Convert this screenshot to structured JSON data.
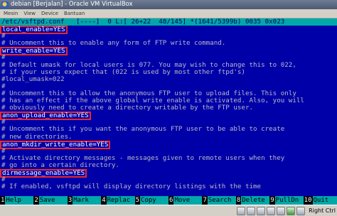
{
  "window": {
    "title": "debian [Berjalan] - Oracle VM VirtualBox"
  },
  "menu": [
    "Mesin",
    "View",
    "Device",
    "Bantuan"
  ],
  "status_line": "/etc/vsftpd.conf   [----]  0 L:[ 26+22  48/145] *(1641/5399b) 0035 0x023",
  "lines": [
    {
      "text": "local_enable=YES",
      "type": "config",
      "highlight": true
    },
    {
      "text": "#",
      "type": "comment"
    },
    {
      "text": "# Uncomment this to enable any form of FTP write command.",
      "type": "comment"
    },
    {
      "text": "write_enable=YES",
      "type": "config",
      "highlight": true
    },
    {
      "text": "#",
      "type": "comment"
    },
    {
      "text": "# Default umask for local users is 077. You may wish to change this to 022,",
      "type": "comment"
    },
    {
      "text": "# if your users expect that (022 is used by most other ftpd's)",
      "type": "comment"
    },
    {
      "text": "#local_umask=022",
      "type": "comment"
    },
    {
      "text": "#",
      "type": "comment"
    },
    {
      "text": "# Uncomment this to allow the anonymous FTP user to upload files. This only",
      "type": "comment"
    },
    {
      "text": "# has an effect if the above global write enable is activated. Also, you will",
      "type": "comment"
    },
    {
      "text": "# obviously need to create a directory writable by the FTP user.",
      "type": "comment"
    },
    {
      "text": "anon_upload_enable=YES",
      "type": "config",
      "highlight": true
    },
    {
      "text": "#",
      "type": "comment"
    },
    {
      "text": "# Uncomment this if you want the anonymous FTP user to be able to create",
      "type": "comment"
    },
    {
      "text": "# new directories.",
      "type": "comment"
    },
    {
      "text": "anon_mkdir_write_enable=YES",
      "type": "config",
      "highlight": true
    },
    {
      "text": "#",
      "type": "comment"
    },
    {
      "text": "# Activate directory messages - messages given to remote users when they",
      "type": "comment"
    },
    {
      "text": "# go into a certain directory.",
      "type": "comment"
    },
    {
      "text": "dirmessage_enable=YES",
      "type": "config",
      "highlight": true
    },
    {
      "text": "#",
      "type": "comment"
    },
    {
      "text": "# If enabled, vsftpd will display directory listings with the time",
      "type": "comment"
    }
  ],
  "function_keys": [
    {
      "num": "1",
      "label": "Help"
    },
    {
      "num": "2",
      "label": "Save"
    },
    {
      "num": "3",
      "label": "Mark"
    },
    {
      "num": "4",
      "label": "Replac"
    },
    {
      "num": "5",
      "label": "Copy"
    },
    {
      "num": "6",
      "label": "Move"
    },
    {
      "num": "7",
      "label": "Search"
    },
    {
      "num": "8",
      "label": "Delete"
    },
    {
      "num": "9",
      "label": "PullDn"
    },
    {
      "num": "10",
      "label": "Quit"
    }
  ],
  "statusbar": {
    "icons": [
      "hard-disk-icon",
      "optical-drive-icon",
      "usb-icon",
      "shared-folder-icon",
      "display-icon",
      "network-icon",
      "mouse-integration-icon"
    ],
    "host_key": "Right Ctrl"
  }
}
